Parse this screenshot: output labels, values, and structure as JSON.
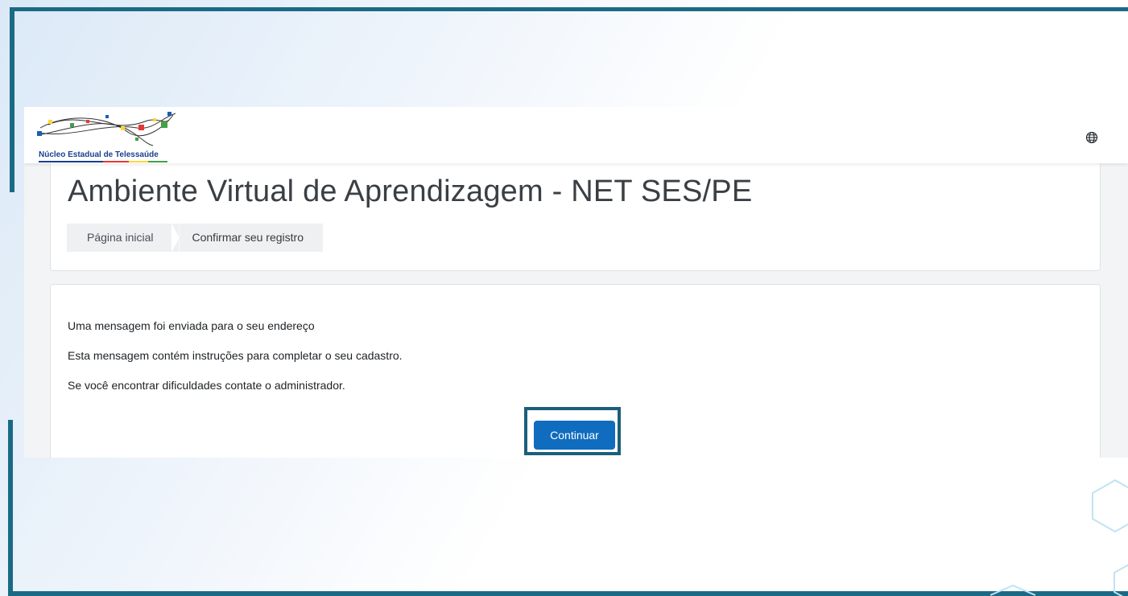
{
  "app": {
    "logo_text": "Núcleo Estadual de Telessaúde",
    "globe_icon": "globe-icon"
  },
  "header": {
    "title": "Ambiente Virtual de Aprendizagem - NET SES/PE",
    "breadcrumb": [
      {
        "label": "Página inicial"
      },
      {
        "label": "Confirmar seu registro"
      }
    ]
  },
  "main": {
    "messages": [
      "Uma mensagem foi enviada para o seu endereço",
      "Esta mensagem contém instruções para completar o seu cadastro.",
      "Se você encontrar dificuldades contate o administrador."
    ],
    "continue_label": "Continuar"
  },
  "colors": {
    "frame": "#1b6a85",
    "primary_button": "#0f6cbf",
    "title_text": "#3a3f44"
  }
}
